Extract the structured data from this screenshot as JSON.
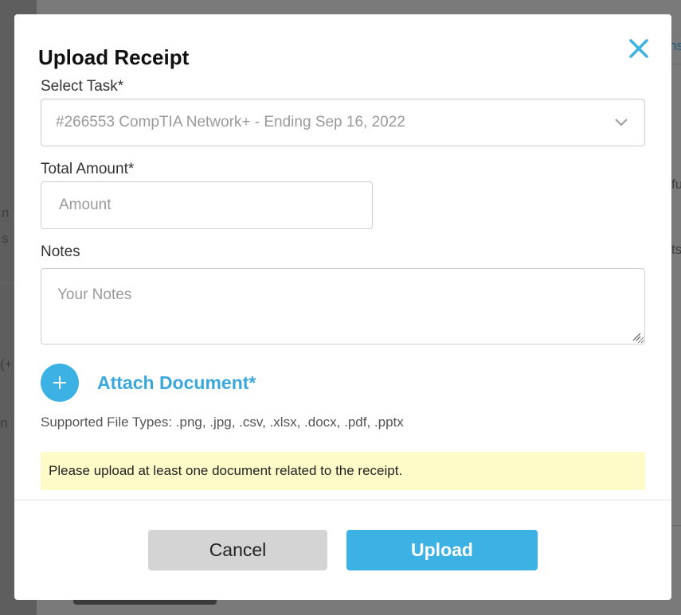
{
  "background": {
    "fragments": [
      "n",
      "s",
      "(+",
      "n",
      "ns",
      "fu",
      "ts"
    ]
  },
  "modal": {
    "title": "Upload Receipt",
    "close_icon": "close-icon",
    "task": {
      "label": "Select Task*",
      "selected": "#266553 CompTIA Network+ - Ending Sep 16, 2022"
    },
    "amount": {
      "label": "Total Amount*",
      "placeholder": "Amount"
    },
    "notes": {
      "label": "Notes",
      "placeholder": "Your Notes"
    },
    "attach": {
      "label": "Attach Document*",
      "icon": "plus-icon"
    },
    "supported_types": "Supported File Types: .png, .jpg, .csv, .xlsx, .docx, .pdf, .pptx",
    "notice": "Please upload at least one document related to the receipt.",
    "buttons": {
      "cancel": "Cancel",
      "upload": "Upload"
    }
  },
  "colors": {
    "accent": "#3cb1e3",
    "notice_bg": "#fefbc8",
    "overlay": "#7a7a7a"
  }
}
